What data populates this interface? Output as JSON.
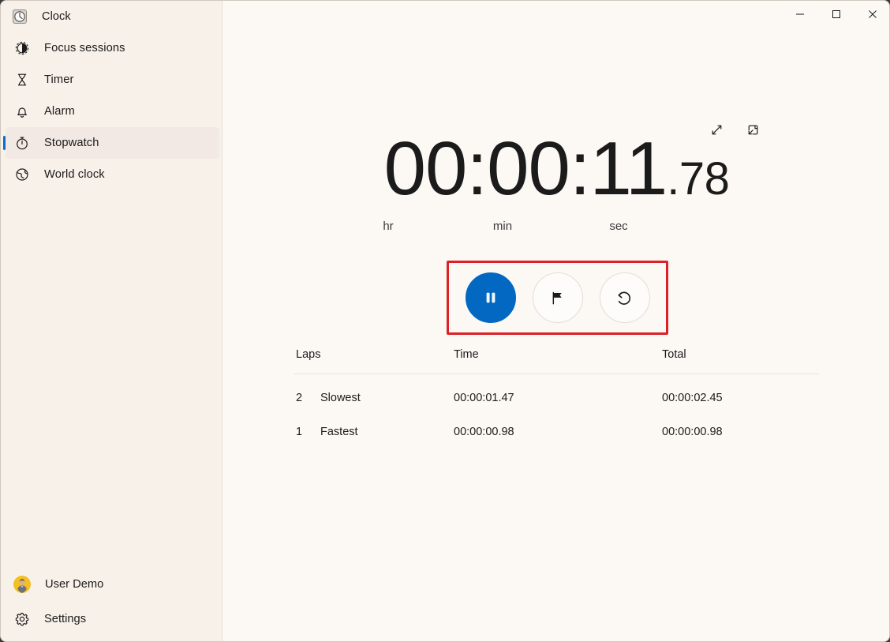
{
  "window": {
    "app_title": "Clock",
    "app_icon": "clock-app-icon",
    "controls": {
      "minimize": "minimize",
      "maximize": "maximize",
      "close": "close"
    }
  },
  "sidebar": {
    "items": [
      {
        "label": "Focus sessions",
        "icon": "focus-sessions-icon",
        "selected": false
      },
      {
        "label": "Timer",
        "icon": "timer-hourglass-icon",
        "selected": false
      },
      {
        "label": "Alarm",
        "icon": "alarm-bell-icon",
        "selected": false
      },
      {
        "label": "Stopwatch",
        "icon": "stopwatch-icon",
        "selected": true
      },
      {
        "label": "World clock",
        "icon": "globe-icon",
        "selected": false
      }
    ],
    "bottom": [
      {
        "label": "User Demo",
        "icon": "user-avatar"
      },
      {
        "label": "Settings",
        "icon": "gear-icon"
      }
    ]
  },
  "stopwatch": {
    "time": "00:00:11",
    "fraction": ".78",
    "units": {
      "hr": "hr",
      "min": "min",
      "sec": "sec"
    },
    "view_actions": [
      {
        "name": "expand-icon",
        "label": "Expand"
      },
      {
        "name": "compact-overlay-icon",
        "label": "Compact overlay"
      }
    ],
    "buttons": [
      {
        "name": "pause-button",
        "label": "Pause",
        "icon": "pause-icon",
        "style": "primary"
      },
      {
        "name": "lap-button",
        "label": "Lap",
        "icon": "flag-icon",
        "style": "secondary"
      },
      {
        "name": "reset-button",
        "label": "Reset",
        "icon": "reset-icon",
        "style": "secondary"
      }
    ],
    "highlight_color": "#de1f26",
    "accent_color": "#0268c1"
  },
  "laps_table": {
    "headers": {
      "laps": "Laps",
      "time": "Time",
      "total": "Total"
    },
    "rows": [
      {
        "num": "2",
        "label": "Slowest",
        "time": "00:00:01.47",
        "total": "00:00:02.45"
      },
      {
        "num": "1",
        "label": "Fastest",
        "time": "00:00:00.98",
        "total": "00:00:00.98"
      }
    ]
  }
}
